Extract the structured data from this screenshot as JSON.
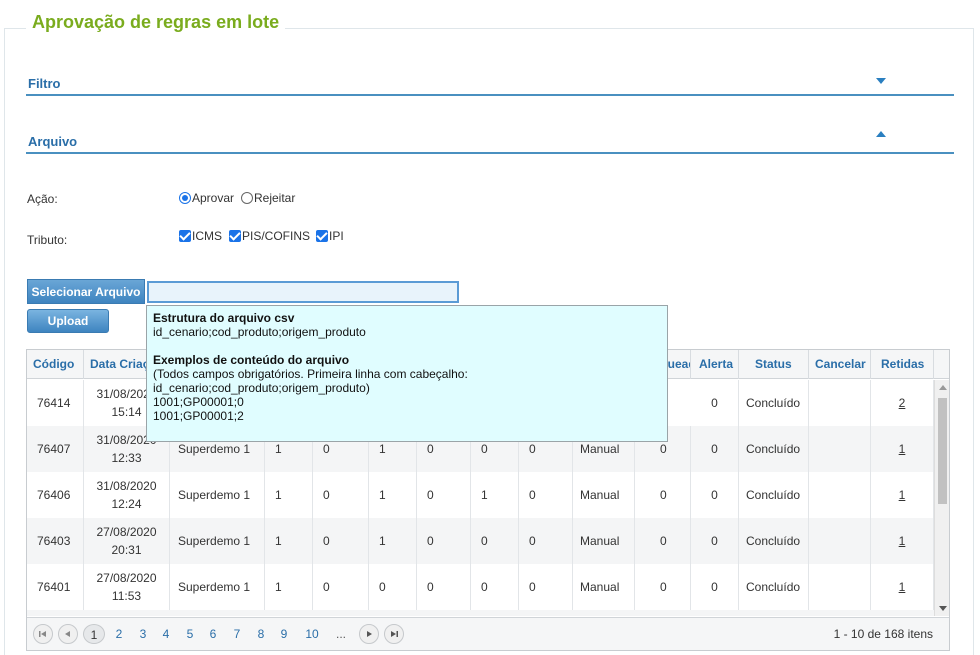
{
  "page": {
    "title": "Aprovação de regras em lote"
  },
  "sections": {
    "filtro": "Filtro",
    "arquivo": "Arquivo"
  },
  "form": {
    "acao_label": "Ação:",
    "acao_options": [
      "Aprovar",
      "Rejeitar"
    ],
    "tributo_label": "Tributo:",
    "tributo_options": [
      "ICMS",
      "PIS/COFINS",
      "IPI"
    ],
    "select_button": "Selecionar Arquivo",
    "file_value": "",
    "upload_button": "Upload"
  },
  "tooltip": {
    "title1": "Estrutura do arquivo csv",
    "line1": "id_cenario;cod_produto;origem_produto",
    "title2": "Exemplos de conteúdo do arquivo",
    "line2": "(Todos campos obrigatórios. Primeira linha com cabeçalho:",
    "line3": "id_cenario;cod_produto;origem_produto)",
    "line4": "1001;GP00001;0",
    "line5": "1001;GP00001;2"
  },
  "grid": {
    "headers": [
      "Código",
      "Data Criação",
      "",
      "",
      "",
      "",
      "",
      "",
      "",
      "Bloqueadas",
      "Alerta",
      "Status",
      "Cancelar",
      "Retidas"
    ],
    "rows": [
      {
        "codigo": "76414",
        "date": "31/08/2020",
        "time": "15:14",
        "usuario": "",
        "c1": "",
        "c2": "",
        "c3": "",
        "c4": "",
        "c5": "",
        "c6": "",
        "tipo": "",
        "bloq": "",
        "alerta": "0",
        "status": "Concluído",
        "retidas": "2"
      },
      {
        "codigo": "76407",
        "date": "31/08/2020",
        "time": "12:33",
        "usuario": "Superdemo 1",
        "c1": "1",
        "c2": "0",
        "c3": "1",
        "c4": "0",
        "c5": "0",
        "c6": "0",
        "tipo": "Manual",
        "bloq": "0",
        "alerta": "0",
        "status": "Concluído",
        "retidas": "1"
      },
      {
        "codigo": "76406",
        "date": "31/08/2020",
        "time": "12:24",
        "usuario": "Superdemo 1",
        "c1": "1",
        "c2": "0",
        "c3": "1",
        "c4": "0",
        "c5": "1",
        "c6": "0",
        "tipo": "Manual",
        "bloq": "0",
        "alerta": "0",
        "status": "Concluído",
        "retidas": "1"
      },
      {
        "codigo": "76403",
        "date": "27/08/2020",
        "time": "20:31",
        "usuario": "Superdemo 1",
        "c1": "1",
        "c2": "0",
        "c3": "1",
        "c4": "0",
        "c5": "0",
        "c6": "0",
        "tipo": "Manual",
        "bloq": "0",
        "alerta": "0",
        "status": "Concluído",
        "retidas": "1"
      },
      {
        "codigo": "76401",
        "date": "27/08/2020",
        "time": "11:53",
        "usuario": "Superdemo 1",
        "c1": "1",
        "c2": "0",
        "c3": "0",
        "c4": "0",
        "c5": "0",
        "c6": "0",
        "tipo": "Manual",
        "bloq": "0",
        "alerta": "0",
        "status": "Concluído",
        "retidas": "1"
      }
    ]
  },
  "pager": {
    "pages": [
      "1",
      "2",
      "3",
      "4",
      "5",
      "6",
      "7",
      "8",
      "9",
      "10",
      "..."
    ],
    "current": "1",
    "info": "1 - 10 de 168 itens"
  },
  "colors": {
    "title": "#7aac1e",
    "accent": "#2a6ea8",
    "tooltip_bg": "#e0fdff"
  }
}
